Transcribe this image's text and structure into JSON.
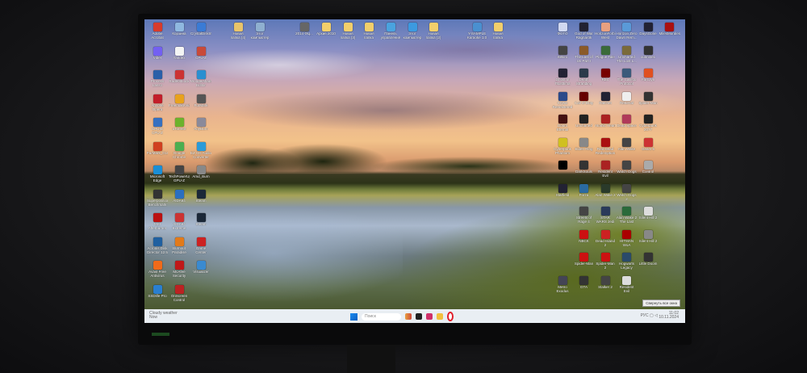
{
  "taskbar": {
    "weather_title": "Cloudy weather",
    "weather_sub": "Now",
    "search_placeholder": "Поиск",
    "clock_time": "11:02",
    "clock_date": "10.11.2024",
    "lang": "РУС",
    "tooltip": "Свернуть все окна"
  },
  "icons_left": [
    [
      "Adobe Acrobat",
      "#d83b2b"
    ],
    [
      "Корзина",
      "#8fb8e0"
    ],
    [
      "CrystalDiskInfo",
      "#3a7bd5"
    ],
    [
      "Viber",
      "#7360f2"
    ],
    [
      "Yandex",
      "#f4f4f4"
    ],
    [
      "CPU-Z",
      "#c84a3a"
    ],
    [
      "Process Lasso",
      "#2a5fa8"
    ],
    [
      "RadeonLock",
      "#c33"
    ],
    [
      "Wondershare Editor",
      "#2a8fd0"
    ],
    [
      "Anyone Opera",
      "#c21e2a"
    ],
    [
      "FreemakeVideo",
      "#e8a21c"
    ],
    [
      "FurMark",
      "#555"
    ],
    [
      "CPUID CPU-Z",
      "#3670c0"
    ],
    [
      "uTorrent",
      "#6cb22c"
    ],
    [
      "AnyBurn",
      "#8a8a9a"
    ],
    [
      "FurMark_GUI",
      "#d04020"
    ],
    [
      "Google Chrome",
      "#4caf50"
    ],
    [
      "EZ CD Audio Converter",
      "#2b9bd8"
    ],
    [
      "Microsoft Edge",
      "#1a8ed6"
    ],
    [
      "TechPowerUp GPU-Z",
      "#444"
    ],
    [
      "Amd_Burn",
      "#888"
    ],
    [
      "Superposition Benchmark",
      "#333"
    ],
    [
      "AIDA64",
      "#2a6fc0"
    ],
    [
      "Steam",
      "#1b2838"
    ],
    [
      "MSI Afterburner",
      "#b11"
    ],
    [
      "AIDA64 Extreme",
      "#c33"
    ],
    [
      "Steam",
      "#1b2838"
    ],
    [
      "Acronis Disk Director 12.5",
      "#2060a0"
    ],
    [
      "Burnout Paradise",
      "#e27a1a"
    ],
    [
      "Game Center",
      "#c22"
    ],
    [
      "Avast Free Antivirus",
      "#f06a1a"
    ],
    [
      "McAfee Security",
      "#c01818"
    ],
    [
      "Visualizer",
      "#3a8ad0"
    ],
    [
      "SSDlife Pro",
      "#2a7fd0"
    ],
    [
      "OnScreen Control",
      "#b22"
    ]
  ],
  "icons_top": [
    [
      "Новая папка (4)",
      "#e9c46a"
    ],
    [
      "Этот компьютер",
      "#8fb0d0"
    ],
    [
      "2014 ФЦ...",
      "#666"
    ],
    [
      "Архив 2010",
      "#f2cf6b"
    ],
    [
      "Новая папка (3)",
      "#f2cf6b"
    ],
    [
      "Новая папка",
      "#f2cf6b"
    ],
    [
      "Панель управления",
      "#4aa3df"
    ],
    [
      "Этот компьютер",
      "#3c9ae0"
    ],
    [
      "Новая папка (2)",
      "#f2cf6b"
    ],
    [
      "Y-SAMPLE Karaoke 1.0",
      "#4a90d0"
    ],
    [
      "Новая папка",
      "#f2cf6b"
    ]
  ],
  "icons_right": [
    [
      "ФОТО",
      "#d0d8f0"
    ],
    [
      "God of War Ragnarök",
      "#223"
    ],
    [
      "HorizonForbidden West",
      "#e8a080"
    ],
    [
      "Horizon Zero Dawn Rem...",
      "#5a9ad8"
    ],
    [
      "DaysGone",
      "#223"
    ],
    [
      "MilesMorales",
      "#a11"
    ],
    [
      "Sekiro",
      "#444"
    ],
    [
      "The Last of Us Part I",
      "#8a5a2a"
    ],
    [
      "Plague Tale",
      "#3a6a3a"
    ],
    [
      "Uncharted The Lost L...",
      "#7a6a3a"
    ],
    [
      "xubnine1",
      "#333"
    ],
    [
      "",
      ""
    ],
    [
      "Ghost of Tsushima",
      "#223"
    ],
    [
      "Death Stranding",
      "#2a3a4a"
    ],
    [
      "RE4",
      "#700"
    ],
    [
      "The Callisto Protocol",
      "#3a5a7a"
    ],
    [
      "FarCry6",
      "#e05020"
    ],
    [
      "",
      ""
    ],
    [
      "Crysis Remastered",
      "#2a4a8a"
    ],
    [
      "Call of Duty",
      "#600"
    ],
    [
      "Ratchet",
      "#223"
    ],
    [
      "Returnal",
      "#eee"
    ],
    [
      "Spider-Man",
      "#333"
    ],
    [
      "",
      ""
    ],
    [
      "Doom Eternal",
      "#411"
    ],
    [
      "Uncharted",
      "#222"
    ],
    [
      "Atomic Heart",
      "#a22"
    ],
    [
      "Dead Space",
      "#b03a5a"
    ],
    [
      "Cyberpunk 2077",
      "#222"
    ],
    [
      "",
      ""
    ],
    [
      "Cyberpunk Phantom",
      "#d0c020"
    ],
    [
      "Elden Ring",
      "#888"
    ],
    [
      "Red Dead Redemption 2",
      "#a11"
    ],
    [
      "Alan Wake",
      "#444"
    ],
    [
      "Gears 5",
      "#c33"
    ],
    [
      "",
      ""
    ],
    [
      "",
      "#000"
    ],
    [
      "DarkSouls",
      "#333"
    ],
    [
      "Resident Evil",
      "#a22"
    ],
    [
      "Watch Dogs",
      "#444"
    ],
    [
      "Control",
      "#aaa"
    ],
    [
      "",
      ""
    ],
    [
      "Starfield",
      "#223"
    ],
    [
      "Forza",
      "#2a6aa0"
    ],
    [
      "Alan Wake 2",
      "#2a3a2a"
    ],
    [
      "Watch Dogs 2",
      "#444"
    ],
    [
      "",
      ""
    ],
    [
      "",
      ""
    ],
    [
      "",
      "",
      ""
    ],
    [
      "Streets of Rage 4",
      "#444"
    ],
    [
      "STAR WARS Jedi Survivor",
      "#2a3a5a"
    ],
    [
      "Alan Wake 2 The Last",
      "#2a6a3a"
    ],
    [
      "Silent Hill 2",
      "#ddd"
    ],
    [
      "",
      ""
    ],
    [
      "",
      "",
      ""
    ],
    [
      "NBCK",
      "#c11"
    ],
    [
      "Dead Island 2",
      "#c22"
    ],
    [
      "HITMAN WoA",
      "#a00"
    ],
    [
      "Silent Hill 2",
      "#888"
    ],
    [
      "",
      ""
    ],
    [
      "",
      "",
      ""
    ],
    [
      "Spider-Man",
      "#c11"
    ],
    [
      "Spider-Man 2",
      "#c11"
    ],
    [
      "Hogwarts Legacy",
      "#2a4a6a"
    ],
    [
      "Little Doom",
      "#333"
    ],
    [
      "",
      ""
    ],
    [
      "Metro Exodus",
      "#445"
    ],
    [
      "GTA",
      "#333"
    ],
    [
      "Stalker 2",
      "#444"
    ],
    [
      "Resident Evil",
      "#ddd"
    ],
    [
      "",
      ""
    ],
    [
      "",
      ""
    ]
  ]
}
